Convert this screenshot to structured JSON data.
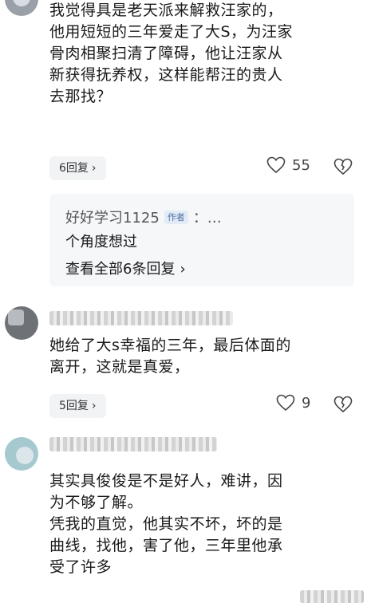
{
  "comment1": {
    "lines": [
      "我觉得具是老天派来解救汪家的，",
      "他用短短的三年爱走了大S，为汪家",
      "骨肉相聚扫清了障碍，他让汪家从",
      "新获得抚养权，这样能帮汪的贵人",
      "去那找？"
    ],
    "replies_label": "6回复",
    "likes": "55"
  },
  "sub_thread": {
    "author": "好好学习1125",
    "author_tag": "作者",
    "author_suffix": "：…",
    "text": "个角度想过",
    "view_all": "查看全部6条回复"
  },
  "comment2": {
    "lines": [
      "她给了大s幸福的三年，最后体面的",
      "离开，这就是真爱，"
    ],
    "replies_label": "5回复",
    "likes": "9"
  },
  "comment3": {
    "lines": [
      "其实具俊俊是不是好人，难讲，因",
      "为不够了解。",
      "凭我的直觉，他其实不坏，坏的是",
      "曲线，找他，害了他，三年里他承",
      "受了许多"
    ]
  },
  "icons": {
    "chevron": "›",
    "heart": "heart-outline-icon",
    "dislike": "broken-heart-icon"
  }
}
